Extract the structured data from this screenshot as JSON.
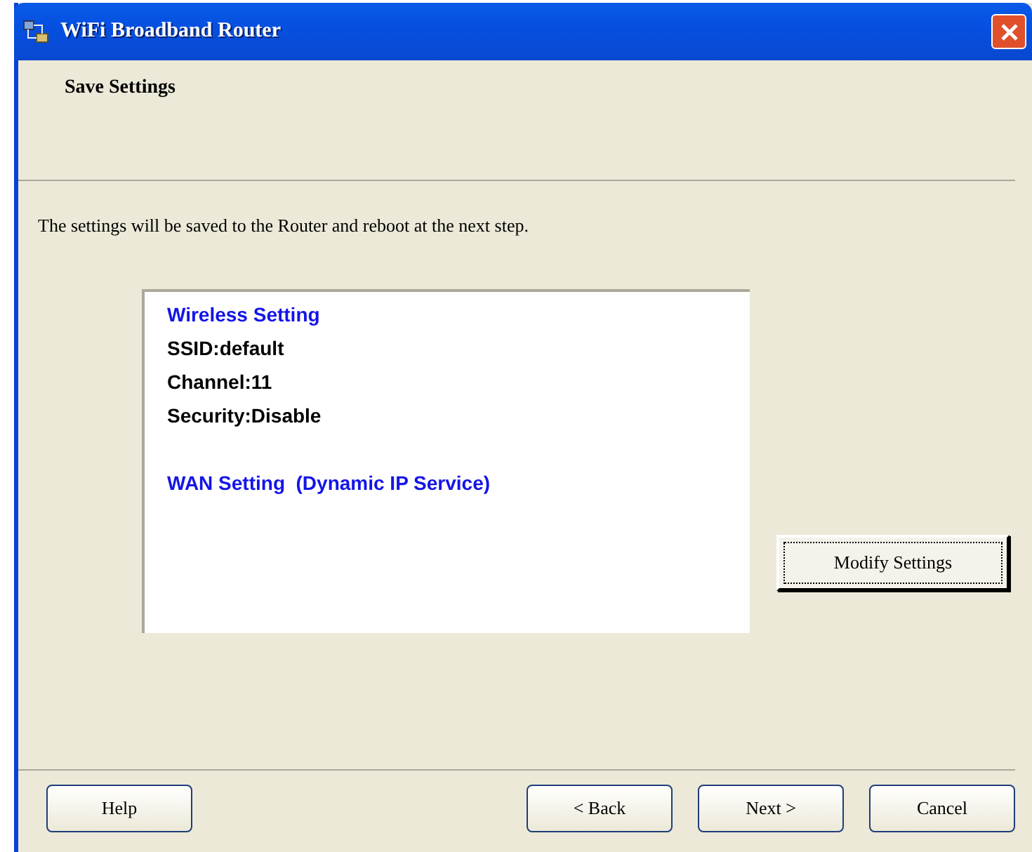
{
  "window": {
    "title": "WiFi Broadband Router"
  },
  "header": {
    "title": "Save Settings"
  },
  "message": "The settings will be saved to the Router and reboot at the next step.",
  "summary": [
    {
      "kind": "heading",
      "text": "Wireless Setting"
    },
    {
      "kind": "item",
      "text": "SSID:default"
    },
    {
      "kind": "item",
      "text": "Channel:11"
    },
    {
      "kind": "item",
      "text": "Security:Disable"
    },
    {
      "kind": "heading",
      "text": "WAN Setting  (Dynamic IP Service)"
    }
  ],
  "modify_button": {
    "label": "Modify Settings",
    "focused": true
  },
  "buttons": [
    {
      "kind": "left",
      "label": "Help"
    },
    {
      "kind": "right",
      "label": "< Back"
    },
    {
      "kind": "right",
      "label": "Next >"
    },
    {
      "kind": "right",
      "label": "Cancel"
    }
  ]
}
